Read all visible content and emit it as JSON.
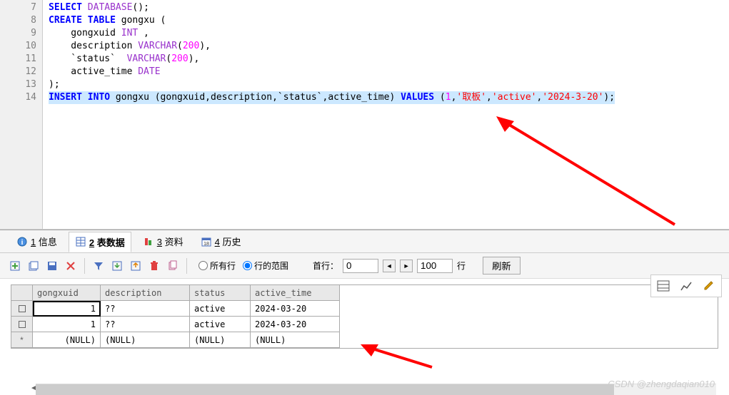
{
  "editor": {
    "lines": [
      {
        "n": "7",
        "tokens": [
          {
            "t": "SELECT",
            "c": "kw"
          },
          {
            "t": " "
          },
          {
            "t": "DATABASE",
            "c": "type"
          },
          {
            "t": "();"
          }
        ]
      },
      {
        "n": "8",
        "tokens": [
          {
            "t": "CREATE",
            "c": "kw"
          },
          {
            "t": " "
          },
          {
            "t": "TABLE",
            "c": "kw"
          },
          {
            "t": " gongxu ("
          }
        ]
      },
      {
        "n": "9",
        "tokens": [
          {
            "t": "    gongxuid "
          },
          {
            "t": "INT",
            "c": "type"
          },
          {
            "t": " ,"
          }
        ]
      },
      {
        "n": "10",
        "tokens": [
          {
            "t": "    description "
          },
          {
            "t": "VARCHAR",
            "c": "type"
          },
          {
            "t": "("
          },
          {
            "t": "200",
            "c": "num"
          },
          {
            "t": "),"
          }
        ]
      },
      {
        "n": "11",
        "tokens": [
          {
            "t": "    `status`  "
          },
          {
            "t": "VARCHAR",
            "c": "type"
          },
          {
            "t": "("
          },
          {
            "t": "200",
            "c": "num"
          },
          {
            "t": "),"
          }
        ]
      },
      {
        "n": "12",
        "tokens": [
          {
            "t": "    active_time "
          },
          {
            "t": "DATE",
            "c": "type"
          }
        ]
      },
      {
        "n": "13",
        "tokens": [
          {
            "t": ");"
          }
        ]
      },
      {
        "n": "14",
        "highlighted": true,
        "tokens": [
          {
            "t": "INSERT",
            "c": "kw"
          },
          {
            "t": " "
          },
          {
            "t": "INTO",
            "c": "kw"
          },
          {
            "t": " gongxu (gongxuid,description,`status`,active_time) "
          },
          {
            "t": "VALUES",
            "c": "kw"
          },
          {
            "t": " ("
          },
          {
            "t": "1",
            "c": "num"
          },
          {
            "t": ","
          },
          {
            "t": "'取板'",
            "c": "str"
          },
          {
            "t": ","
          },
          {
            "t": "'active'",
            "c": "str"
          },
          {
            "t": ","
          },
          {
            "t": "'2024-3-20'",
            "c": "str"
          },
          {
            "t": ");"
          }
        ]
      }
    ]
  },
  "tabs": {
    "info": {
      "key": "1",
      "label": "信息"
    },
    "data": {
      "key": "2",
      "label": "表数据"
    },
    "material": {
      "key": "3",
      "label": "资料"
    },
    "history": {
      "key": "4",
      "label": "历史"
    }
  },
  "toolbar": {
    "radio_all": "所有行",
    "radio_range": "行的范围",
    "first_row_label": "首行：",
    "first_row_value": "0",
    "row_count_value": "100",
    "row_unit": "行",
    "refresh": "刷新"
  },
  "grid": {
    "headers": {
      "id": "gongxuid",
      "desc": "description",
      "status": "status",
      "time": "active_time"
    },
    "rows": [
      {
        "marker": "checkbox",
        "id": "1",
        "desc": "??",
        "status": "active",
        "time": "2024-03-20",
        "selected": true
      },
      {
        "marker": "checkbox",
        "id": "1",
        "desc": "??",
        "status": "active",
        "time": "2024-03-20"
      },
      {
        "marker": "star",
        "id": "(NULL)",
        "desc": "(NULL)",
        "status": "(NULL)",
        "time": "(NULL)"
      }
    ]
  },
  "watermark": "CSDN @zhengdaqian010"
}
